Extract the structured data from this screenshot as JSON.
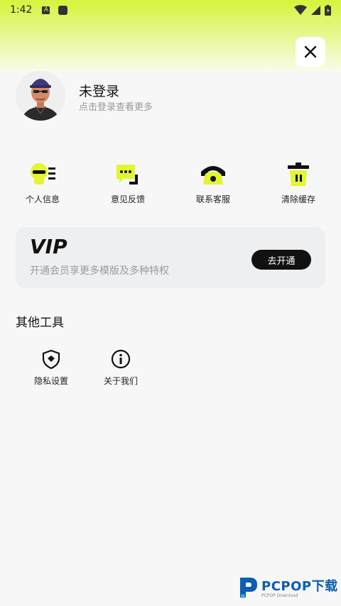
{
  "status_bar": {
    "time": "1:42",
    "notif_icon_letter": "A"
  },
  "profile": {
    "name": "未登录",
    "subtitle": "点击登录查看更多"
  },
  "quick_actions": [
    {
      "label": "个人信息",
      "icon": "profile-card-icon"
    },
    {
      "label": "意见反馈",
      "icon": "feedback-chat-icon"
    },
    {
      "label": "联系客服",
      "icon": "phone-icon"
    },
    {
      "label": "清除缓存",
      "icon": "trash-icon"
    }
  ],
  "vip": {
    "logo": "VIP",
    "description": "开通会员享更多模版及多种特权",
    "button_label": "去开通"
  },
  "other_tools": {
    "title": "其他工具",
    "items": [
      {
        "label": "隐私设置",
        "icon": "shield-icon"
      },
      {
        "label": "关于我们",
        "icon": "info-icon"
      }
    ]
  },
  "watermark": {
    "brand": "PCPOP下载",
    "sub": "PCPOP Download"
  },
  "colors": {
    "accent": "#d5f43b",
    "icon_yellow": "#e4f531",
    "dark": "#111111",
    "watermark_blue": "#0c5db4"
  }
}
